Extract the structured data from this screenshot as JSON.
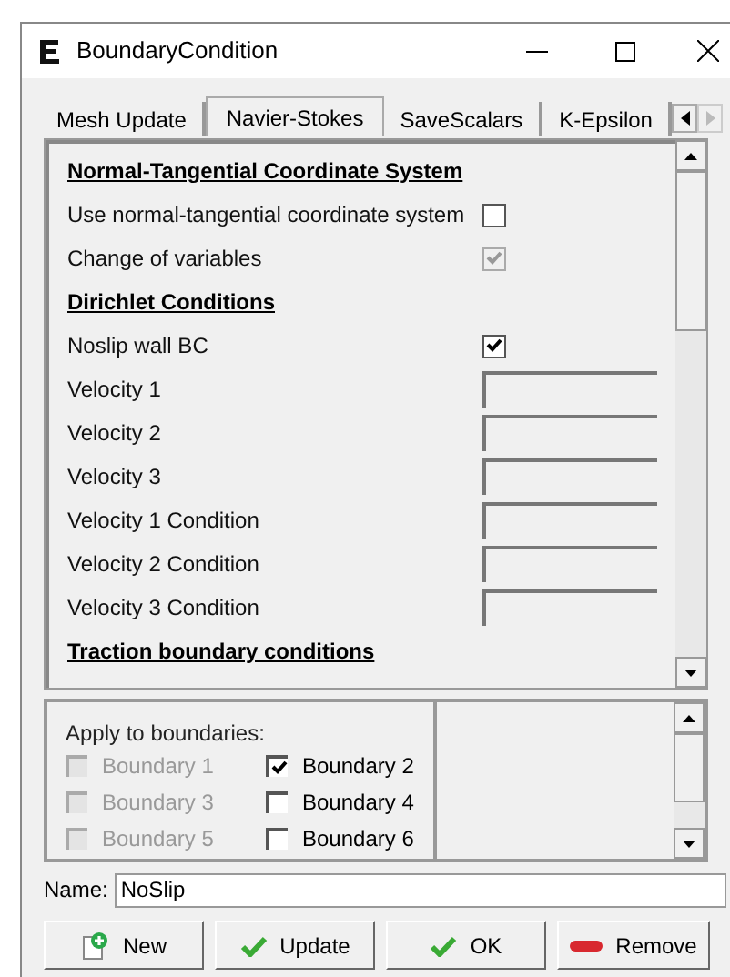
{
  "window": {
    "title": "BoundaryCondition"
  },
  "tabs": [
    {
      "label": "Mesh Update",
      "selected": false
    },
    {
      "label": "Navier-Stokes",
      "selected": true
    },
    {
      "label": "SaveScalars",
      "selected": false
    },
    {
      "label": "K-Epsilon",
      "selected": false
    }
  ],
  "form": [
    {
      "kind": "heading",
      "label": "Normal-Tangential Coordinate System"
    },
    {
      "kind": "checkbox",
      "label": "Use normal-tangential coordinate system",
      "checked": false,
      "disabled": false
    },
    {
      "kind": "checkbox",
      "label": "Change of variables",
      "checked": true,
      "disabled": true
    },
    {
      "kind": "heading",
      "label": "Dirichlet Conditions"
    },
    {
      "kind": "checkbox",
      "label": "Noslip wall BC",
      "checked": true,
      "disabled": false
    },
    {
      "kind": "field",
      "label": "Velocity 1"
    },
    {
      "kind": "field",
      "label": "Velocity 2"
    },
    {
      "kind": "field",
      "label": "Velocity 3"
    },
    {
      "kind": "field",
      "label": "Velocity 1 Condition"
    },
    {
      "kind": "field",
      "label": "Velocity 2 Condition"
    },
    {
      "kind": "field",
      "label": "Velocity 3 Condition"
    },
    {
      "kind": "heading",
      "label": "Traction boundary conditions"
    }
  ],
  "boundaries": {
    "title": "Apply to boundaries:",
    "items": [
      {
        "label": "Boundary 1",
        "checked": false,
        "disabled": true
      },
      {
        "label": "Boundary 2",
        "checked": true,
        "disabled": false
      },
      {
        "label": "Boundary 3",
        "checked": false,
        "disabled": true
      },
      {
        "label": "Boundary 4",
        "checked": false,
        "disabled": false
      },
      {
        "label": "Boundary 5",
        "checked": false,
        "disabled": true
      },
      {
        "label": "Boundary 6",
        "checked": false,
        "disabled": false
      }
    ]
  },
  "name": {
    "label": "Name:",
    "value": "NoSlip"
  },
  "buttons": [
    {
      "kind": "new",
      "label": "New"
    },
    {
      "kind": "update",
      "label": "Update"
    },
    {
      "kind": "ok",
      "label": "OK"
    },
    {
      "kind": "remove",
      "label": "Remove"
    }
  ]
}
